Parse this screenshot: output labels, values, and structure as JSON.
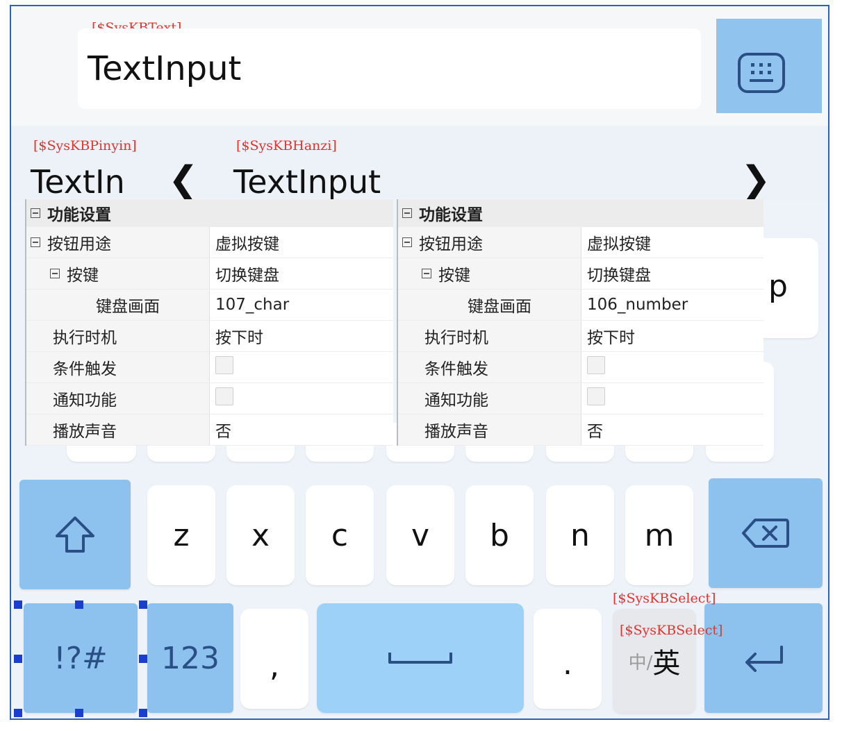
{
  "text_area": {
    "var_label": "[$SysKBText]",
    "value": "TextInput",
    "keyboard_icon": "keyboard-icon"
  },
  "candidates": {
    "pinyin_var": "[$SysKBPinyin]",
    "pinyin_value": "TextIn",
    "hanzi_var": "[$SysKBHanzi]",
    "hanzi_value": "TextInput",
    "prev_arrow": "❮",
    "next_arrow": "❯"
  },
  "keys": {
    "partial_p": "p",
    "row3": [
      "z",
      "x",
      "c",
      "v",
      "b",
      "n",
      "m"
    ],
    "symbols": "!?#",
    "numbers": "123",
    "comma": ",",
    "period": ".",
    "lang_small": "中/",
    "lang_big": "英",
    "select_var_1": "[$SysKBSelect]",
    "select_var_2": "[$SysKBSelect]",
    "shift_icon": "shift-up-arrow-icon",
    "backspace_icon": "backspace-icon",
    "enter_icon": "enter-return-icon",
    "space_icon": "space-bar-icon"
  },
  "panels": [
    {
      "header": "功能设置",
      "button_purpose_label": "按钮用途",
      "button_purpose_value": "虚拟按键",
      "key_label": "按键",
      "key_value": "切换键盘",
      "screen_label": "键盘画面",
      "screen_value": "107_char",
      "timing_label": "执行时机",
      "timing_value": "按下时",
      "condition_label": "条件触发",
      "notify_label": "通知功能",
      "sound_label": "播放声音",
      "sound_value": "否"
    },
    {
      "header": "功能设置",
      "button_purpose_label": "按钮用途",
      "button_purpose_value": "虚拟按键",
      "key_label": "按键",
      "key_value": "切换键盘",
      "screen_label": "键盘画面",
      "screen_value": "106_number",
      "timing_label": "执行时机",
      "timing_value": "按下时",
      "condition_label": "条件触发",
      "notify_label": "通知功能",
      "sound_label": "播放声音",
      "sound_value": "否"
    }
  ]
}
